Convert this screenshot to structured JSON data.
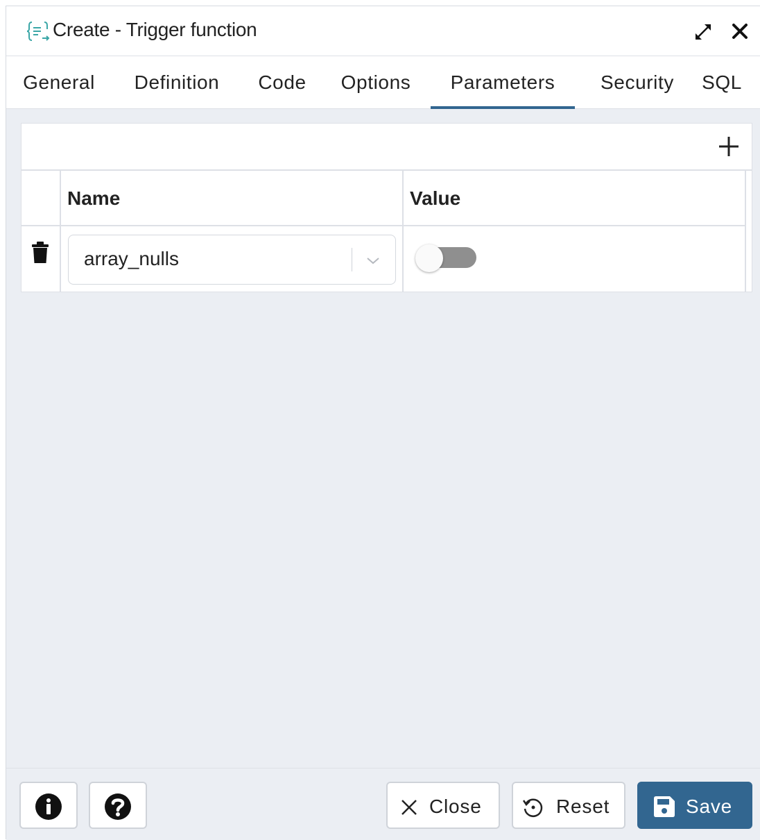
{
  "dialog": {
    "title": "Create - Trigger function",
    "icon": "trigger-function-icon"
  },
  "tabs": [
    {
      "label": "General",
      "active": false
    },
    {
      "label": "Definition",
      "active": false
    },
    {
      "label": "Code",
      "active": false
    },
    {
      "label": "Options",
      "active": false
    },
    {
      "label": "Parameters",
      "active": true
    },
    {
      "label": "Security",
      "active": false
    },
    {
      "label": "SQL",
      "active": false
    }
  ],
  "parameters_grid": {
    "columns": {
      "name": "Name",
      "value": "Value"
    },
    "rows": [
      {
        "name": "array_nulls",
        "value_on": false
      }
    ]
  },
  "footer": {
    "info_icon": "info-icon",
    "help_icon": "help-icon",
    "close_label": "Close",
    "reset_label": "Reset",
    "save_label": "Save"
  },
  "colors": {
    "accent": "#326690",
    "background": "#ebeef3",
    "icon_teal": "#3aa6a6"
  }
}
